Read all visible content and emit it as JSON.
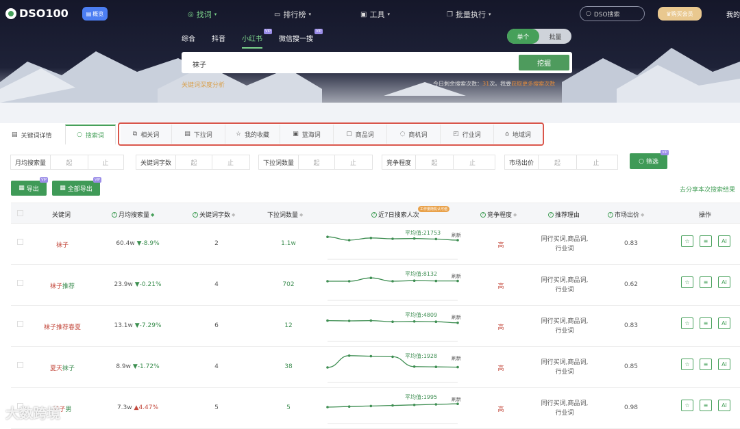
{
  "app": {
    "name": "DSO100",
    "overview_label": "概览"
  },
  "topnav": {
    "items": [
      {
        "label": "找词",
        "active": true
      },
      {
        "label": "排行榜",
        "active": false
      },
      {
        "label": "工具",
        "active": false
      },
      {
        "label": "批量执行",
        "active": false
      }
    ],
    "search_placeholder": "DSO搜索",
    "vip_label": "购买会员",
    "mine_label": "我的"
  },
  "platform_tabs": [
    {
      "label": "综合",
      "active": false,
      "vip": ""
    },
    {
      "label": "抖音",
      "active": false,
      "vip": ""
    },
    {
      "label": "小红书",
      "active": true,
      "vip": "VIP"
    },
    {
      "label": "微信搜一搜",
      "active": false,
      "vip": "VIP"
    }
  ],
  "mode": {
    "single": "单个",
    "batch": "批量"
  },
  "search": {
    "value": "袜子",
    "button": "挖掘"
  },
  "deep_analysis_link": "关键词深度分析",
  "quota": {
    "prefix": "今日剩余搜索次数：",
    "count": "31",
    "suffix": "次。我要",
    "link": "获取更多搜索次数"
  },
  "left_tabs": [
    {
      "label": "关键词详情",
      "active": false
    },
    {
      "label": "搜索词",
      "active": true
    }
  ],
  "box_tabs": [
    "相关词",
    "下拉词",
    "我的收藏",
    "蓝海词",
    "商品词",
    "商机词",
    "行业词",
    "地域词"
  ],
  "filters": [
    {
      "label": "月均搜索量",
      "from": "起",
      "to": "止"
    },
    {
      "label": "关键词字数",
      "from": "起",
      "to": "止"
    },
    {
      "label": "下拉词数量",
      "from": "起",
      "to": "止"
    },
    {
      "label": "竞争程度",
      "from": "起",
      "to": "止"
    },
    {
      "label": "市场出价",
      "from": "起",
      "to": "止"
    }
  ],
  "filter_button": "筛选",
  "export": {
    "label": "导出",
    "all_label": "全部导出",
    "vip": "VIP"
  },
  "share_label": "去分享本次搜索结果",
  "columns": {
    "keyword": "关键词",
    "monthly": "月均搜索量",
    "length": "关键词字数",
    "dropdown": "下拉词数量",
    "week": "近7日搜索人次",
    "week_tag": "工作量随机认可值",
    "competition": "竞争程度",
    "reason": "推荐理由",
    "bid": "市场出价",
    "ops": "操作"
  },
  "rows": [
    {
      "kw_plain": "袜子",
      "kw_green": "",
      "monthly": "60.4w",
      "change": "-8.9%",
      "dir": "down",
      "length": "2",
      "dropdown": "1.1w",
      "avg": "平均值:21753",
      "refresh": "刷新",
      "series": [
        0.62,
        0.5,
        0.58,
        0.55,
        0.56,
        0.54,
        0.5
      ],
      "competition": "高",
      "reason1": "同行买词,商品词,",
      "reason2": "行业词",
      "bid": "0.83"
    },
    {
      "kw_plain": "袜子",
      "kw_green": "推荐",
      "monthly": "23.9w",
      "change": "-0.21%",
      "dir": "down",
      "length": "4",
      "dropdown": "702",
      "avg": "平均值:8132",
      "refresh": "刷新",
      "series": [
        0.5,
        0.5,
        0.62,
        0.5,
        0.52,
        0.51,
        0.51
      ],
      "competition": "高",
      "reason1": "同行买词,商品词,",
      "reason2": "行业词",
      "bid": "0.62"
    },
    {
      "kw_plain": "袜子推荐春夏",
      "kw_green": "",
      "monthly": "13.1w",
      "change": "-7.29%",
      "dir": "down",
      "length": "6",
      "dropdown": "12",
      "avg": "平均值:4809",
      "refresh": "刷新",
      "series": [
        0.56,
        0.55,
        0.56,
        0.52,
        0.53,
        0.52,
        0.48
      ],
      "competition": "高",
      "reason1": "同行买词,商品词,",
      "reason2": "行业词",
      "bid": "0.83"
    },
    {
      "kw_plain": "夏天",
      "kw_green": "袜子",
      "monthly": "8.9w",
      "change": "-1.72%",
      "dir": "down",
      "length": "4",
      "dropdown": "38",
      "avg": "平均值:1928",
      "refresh": "刷新",
      "series": [
        0.35,
        0.78,
        0.76,
        0.74,
        0.38,
        0.37,
        0.36
      ],
      "competition": "高",
      "reason1": "同行买词,商品词,",
      "reason2": "行业词",
      "bid": "0.85"
    },
    {
      "kw_plain": "袜子",
      "kw_green": "男",
      "monthly": "7.3w",
      "change": "4.47%",
      "dir": "up",
      "length": "5",
      "dropdown": "5",
      "avg": "平均值:1995",
      "refresh": "刷新",
      "series": [
        0.4,
        0.42,
        0.44,
        0.46,
        0.48,
        0.5,
        0.52
      ],
      "competition": "高",
      "reason1": "同行买词,商品词,",
      "reason2": "行业词",
      "bid": "0.98"
    }
  ],
  "row_ops": [
    "star-icon",
    "list-icon",
    "ai-icon"
  ],
  "ai_label": "AI",
  "watermark": "大数跨境",
  "colors": {
    "accent": "#46a05a",
    "danger": "#c44b3f",
    "highlight_box": "#d9554a"
  }
}
